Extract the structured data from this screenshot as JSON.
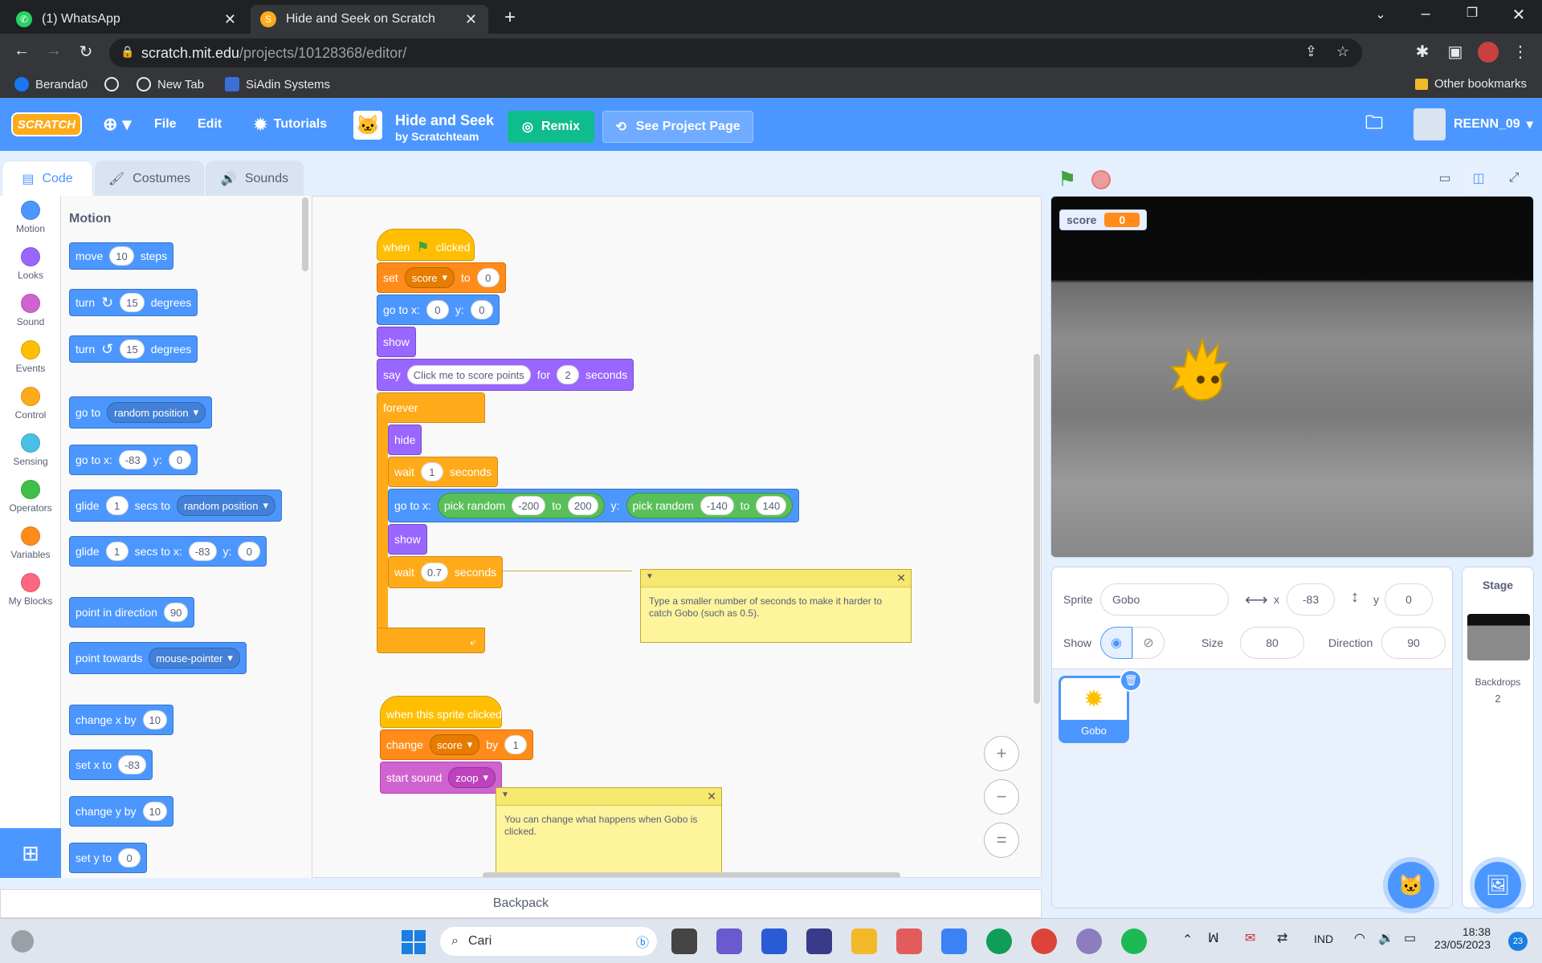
{
  "browser": {
    "tabs": [
      {
        "title": "(1) WhatsApp"
      },
      {
        "title": "Hide and Seek on Scratch"
      }
    ],
    "url_host": "scratch.mit.edu",
    "url_path": "/projects/10128368/editor/",
    "bookmarks": [
      "Beranda0",
      "New Tab",
      "SiAdin Systems"
    ],
    "other_bookmarks": "Other bookmarks"
  },
  "menu": {
    "logo": "SCRATCH",
    "file": "File",
    "edit": "Edit",
    "tutorials": "Tutorials",
    "project_title": "Hide and Seek",
    "project_author": "by Scratchteam",
    "remix": "Remix",
    "see_project": "See Project Page",
    "username": "REENN_09"
  },
  "editor_tabs": {
    "code": "Code",
    "costumes": "Costumes",
    "sounds": "Sounds"
  },
  "categories": [
    {
      "label": "Motion",
      "color": "#4c97ff"
    },
    {
      "label": "Looks",
      "color": "#9966ff"
    },
    {
      "label": "Sound",
      "color": "#cf63cf"
    },
    {
      "label": "Events",
      "color": "#ffbf00"
    },
    {
      "label": "Control",
      "color": "#ffab19"
    },
    {
      "label": "Sensing",
      "color": "#4cbfe6"
    },
    {
      "label": "Operators",
      "color": "#40bf4a"
    },
    {
      "label": "Variables",
      "color": "#ff8c1a"
    },
    {
      "label": "My Blocks",
      "color": "#ff6680"
    }
  ],
  "palette": {
    "heading": "Motion",
    "move": {
      "a": "move",
      "n": "10",
      "b": "steps"
    },
    "turn_cw": {
      "a": "turn",
      "n": "15",
      "b": "degrees"
    },
    "turn_ccw": {
      "a": "turn",
      "n": "15",
      "b": "degrees"
    },
    "goto": {
      "a": "go to",
      "dd": "random position"
    },
    "gotoxy": {
      "a": "go to x:",
      "x": "-83",
      "y_lbl": "y:",
      "y": "0"
    },
    "glide_to": {
      "a": "glide",
      "n": "1",
      "b": "secs to",
      "dd": "random position"
    },
    "glide_xy": {
      "a": "glide",
      "n": "1",
      "b": "secs to x:",
      "x": "-83",
      "y_lbl": "y:",
      "y": "0"
    },
    "point_dir": {
      "a": "point in direction",
      "n": "90"
    },
    "point_towards": {
      "a": "point towards",
      "dd": "mouse-pointer"
    },
    "change_x": {
      "a": "change x by",
      "n": "10"
    },
    "set_x": {
      "a": "set x to",
      "n": "-83"
    },
    "change_y": {
      "a": "change y by",
      "n": "10"
    },
    "set_y": {
      "a": "set y to",
      "n": "0"
    }
  },
  "script1": {
    "when_a": "when",
    "when_b": "clicked",
    "set_a": "set",
    "set_var": "score",
    "set_b": "to",
    "set_val": "0",
    "goto_a": "go to x:",
    "goto_x": "0",
    "goto_y_lbl": "y:",
    "goto_y": "0",
    "show": "show",
    "say_a": "say",
    "say_text": "Click me to score points",
    "say_b": "for",
    "say_n": "2",
    "say_c": "seconds",
    "forever": "forever",
    "hide": "hide",
    "wait1_a": "wait",
    "wait1_n": "1",
    "wait1_b": "seconds",
    "goto2_a": "go to x:",
    "pr1_a": "pick random",
    "pr1_from": "-200",
    "pr1_to_lbl": "to",
    "pr1_to": "200",
    "goto2_y_lbl": "y:",
    "pr2_a": "pick random",
    "pr2_from": "-140",
    "pr2_to_lbl": "to",
    "pr2_to": "140",
    "show2": "show",
    "wait2_a": "wait",
    "wait2_n": "0.7",
    "wait2_b": "seconds"
  },
  "note1": "Type a smaller number of seconds to make it harder to catch Gobo (such as 0.5).",
  "script2": {
    "hat": "when this sprite clicked",
    "change_a": "change",
    "change_var": "score",
    "change_b": "by",
    "change_n": "1",
    "sound_a": "start sound",
    "sound_dd": "zoop"
  },
  "note2": "You can change what happens when Gobo is clicked.",
  "stage": {
    "monitor_label": "score",
    "monitor_value": "0"
  },
  "sprite_info": {
    "sprite_lbl": "Sprite",
    "sprite_name": "Gobo",
    "x_lbl": "x",
    "x": "-83",
    "y_lbl": "y",
    "y": "0",
    "show_lbl": "Show",
    "size_lbl": "Size",
    "size": "80",
    "dir_lbl": "Direction",
    "dir": "90"
  },
  "sprite_tile": "Gobo",
  "stage_pane": {
    "title": "Stage",
    "backdrops_lbl": "Backdrops",
    "backdrops_n": "2"
  },
  "backpack": "Backpack",
  "taskbar": {
    "search": "Cari",
    "lang": "IND",
    "time": "18:38",
    "date": "23/05/2023",
    "badge": "23"
  }
}
